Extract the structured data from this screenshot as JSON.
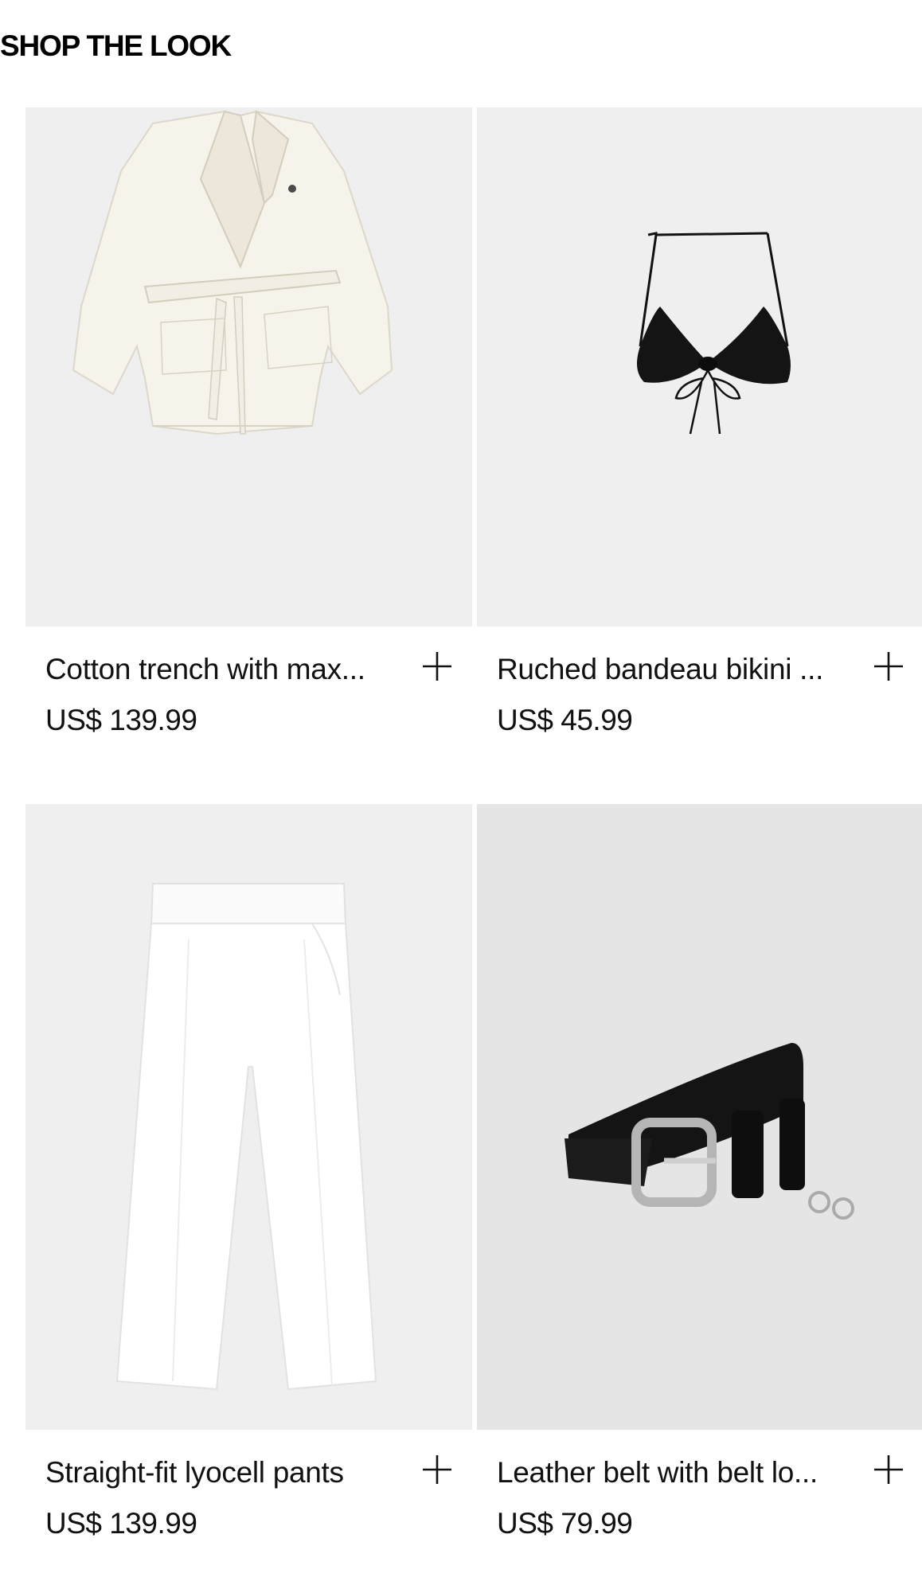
{
  "section": {
    "title": "SHOP THE LOOK"
  },
  "products": [
    {
      "name": "Cotton trench with max...",
      "price": "US$ 139.99",
      "add_icon": "plus-icon",
      "image": "cream-cotton-trench-jacket"
    },
    {
      "name": "Ruched bandeau bikini ...",
      "price": "US$ 45.99",
      "add_icon": "plus-icon",
      "image": "black-halter-bikini-top"
    },
    {
      "name": "Straight-fit lyocell pants",
      "price": "US$ 139.99",
      "add_icon": "plus-icon",
      "image": "white-wide-leg-pants"
    },
    {
      "name": "Leather belt with belt lo...",
      "price": "US$ 79.99",
      "add_icon": "plus-icon",
      "image": "black-leather-belt"
    }
  ],
  "colors": {
    "image_background": "#efeff0",
    "text": "#111111"
  }
}
